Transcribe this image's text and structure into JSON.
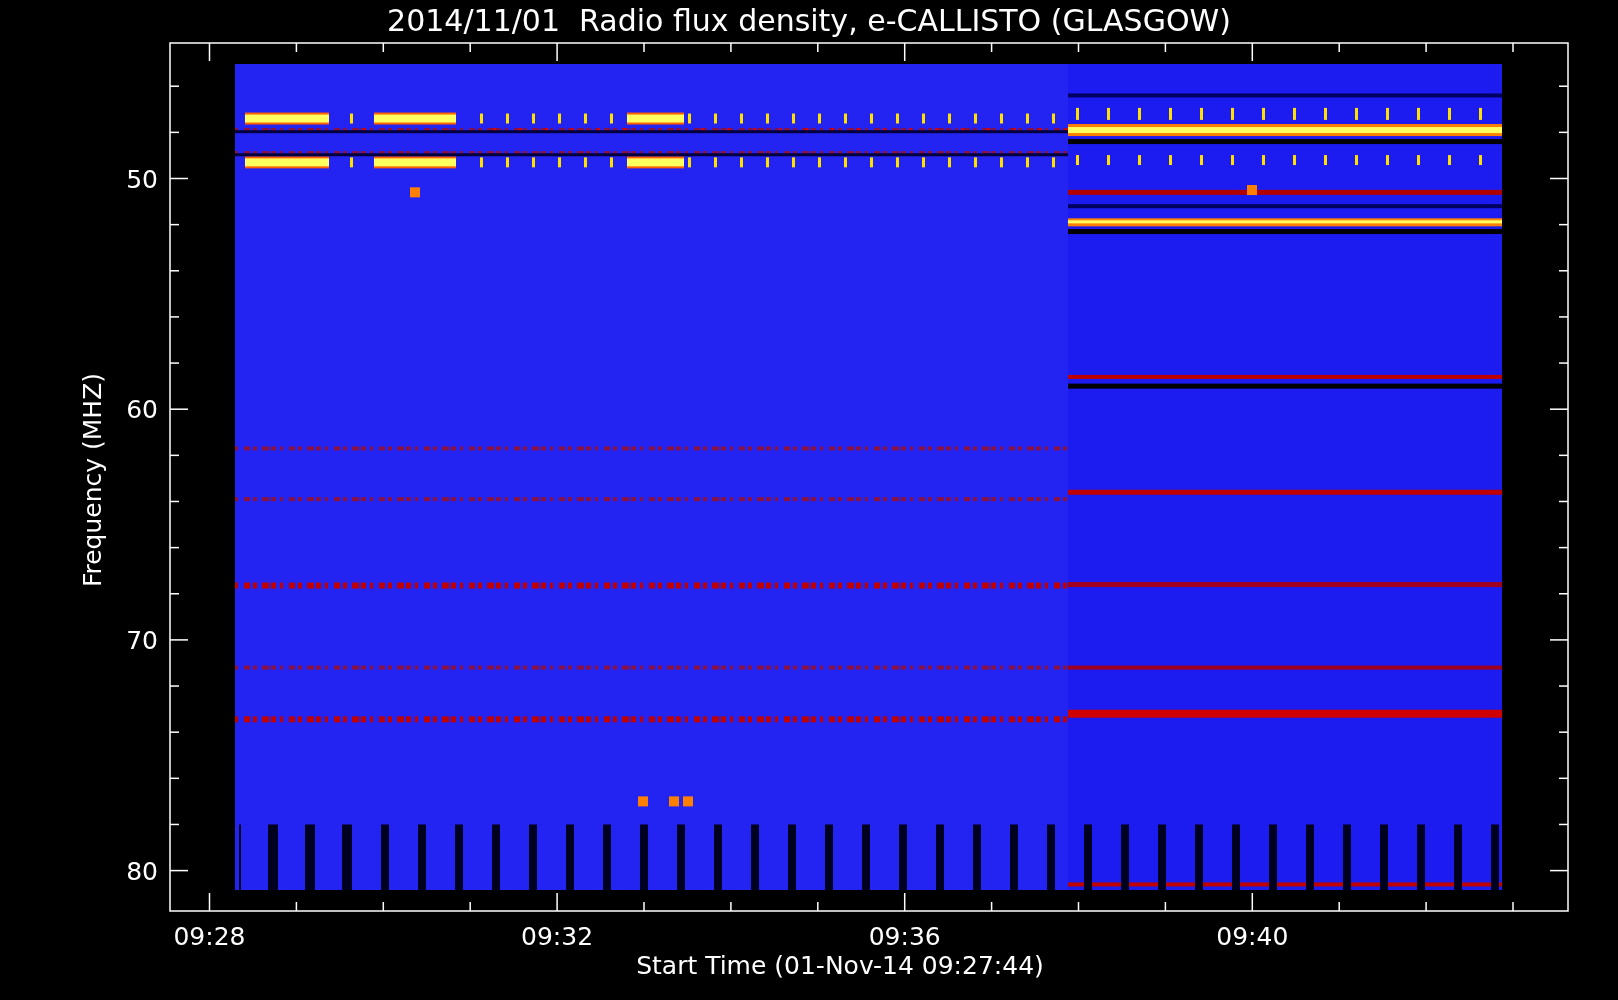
{
  "title": "2014/11/01  Radio flux density, e-CALLISTO (GLASGOW)",
  "y_axis": {
    "label": "Frequency (MHZ)",
    "ticks": [
      "50",
      "60",
      "70",
      "80"
    ]
  },
  "x_axis": {
    "label": "Start Time (01-Nov-14 09:27:44)",
    "ticks": [
      "09:28",
      "09:32",
      "09:36",
      "09:40"
    ]
  }
}
